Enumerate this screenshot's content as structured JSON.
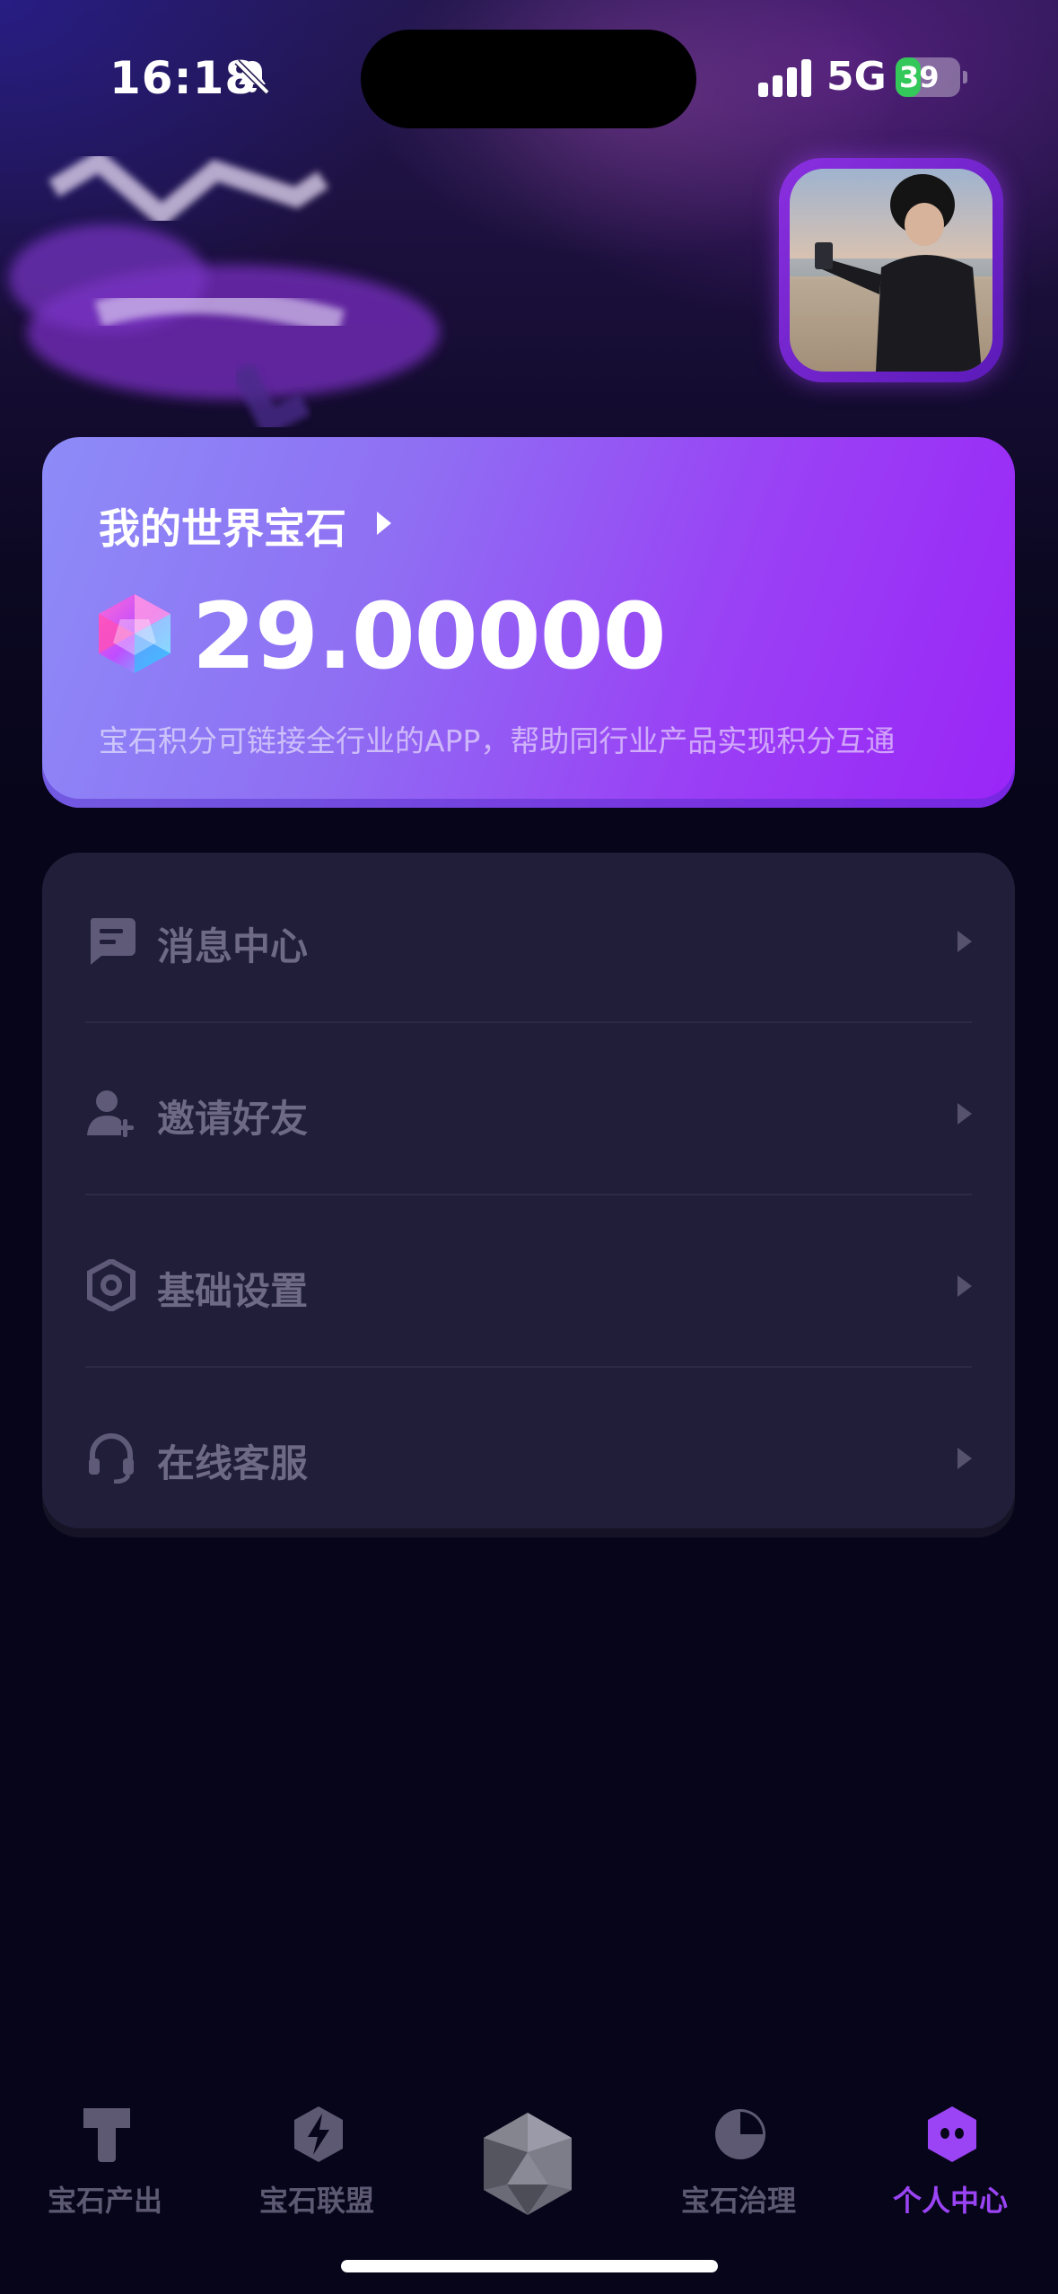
{
  "status_bar": {
    "time": "16:18",
    "network": "5G",
    "battery_percent": "39",
    "battery_level": 0.39
  },
  "gem_card": {
    "title": "我的世界宝石",
    "value": "29.00000",
    "description": "宝石积分可链接全行业的APP，帮助同行业产品实现积分互通"
  },
  "menu": {
    "items": [
      {
        "label": "消息中心",
        "icon": "message-icon"
      },
      {
        "label": "邀请好友",
        "icon": "add-user-icon"
      },
      {
        "label": "基础设置",
        "icon": "settings-hexagon-icon"
      },
      {
        "label": "在线客服",
        "icon": "headset-icon"
      }
    ]
  },
  "tab_bar": {
    "tabs": [
      {
        "label": "宝石产出",
        "icon": "t-block-icon",
        "active": false
      },
      {
        "label": "宝石联盟",
        "icon": "lightning-hexagon-icon",
        "active": false
      },
      {
        "label": "",
        "icon": "gem-center-icon",
        "active": false
      },
      {
        "label": "宝石治理",
        "icon": "pie-chart-icon",
        "active": false
      },
      {
        "label": "个人中心",
        "icon": "profile-hexagon-icon",
        "active": true
      }
    ]
  },
  "colors": {
    "accent": "#9b44f5",
    "card_gradient_start": "#8d8cf8",
    "card_gradient_end": "#9a25f7",
    "menu_bg": "#211e3a",
    "page_bg": "#07051a"
  }
}
